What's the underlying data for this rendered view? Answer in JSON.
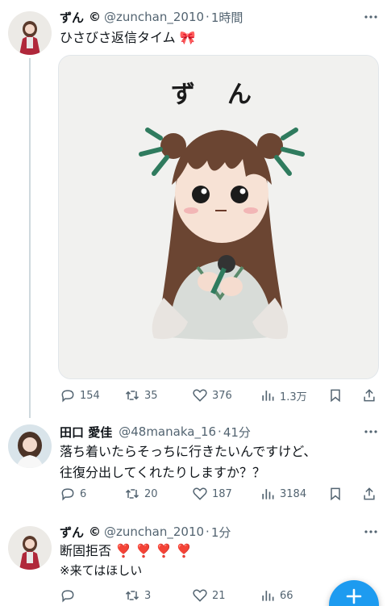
{
  "tweets": [
    {
      "name": "ずん",
      "name_mark": "©",
      "handle": "@zunchan_2010",
      "separator": "·",
      "time": "1時間",
      "text_lines": [
        "ひさびさ返信タイム 🎀"
      ],
      "media": {
        "caption_text": "ずん"
      },
      "stats": {
        "replies": "154",
        "retweets": "35",
        "likes": "376",
        "views": "1.3万"
      }
    },
    {
      "name": "田口 愛佳",
      "handle": "@48manaka_16",
      "separator": "·",
      "time": "41分",
      "text_lines": [
        "落ち着いたらそっちに行きたいんですけど、",
        "往復分出してくれたりしますか？？"
      ],
      "stats": {
        "replies": "6",
        "retweets": "20",
        "likes": "187",
        "views": "3184"
      }
    },
    {
      "name": "ずん",
      "name_mark": "©",
      "handle": "@zunchan_2010",
      "separator": "·",
      "time": "1分",
      "text_lines": [
        "断固拒否 ❣️ ❣️ ❣️ ❣️",
        "※来てはほしい"
      ],
      "stats": {
        "replies": "",
        "retweets": "3",
        "likes": "21",
        "views": "66"
      }
    }
  ],
  "colors": {
    "accent": "#1d9bf0",
    "muted": "#536471",
    "text": "#0f1419",
    "thread_line": "#cfd9de"
  },
  "icons": [
    "reply-icon",
    "retweet-icon",
    "like-icon",
    "views-icon",
    "bookmark-icon",
    "share-icon",
    "more-icon",
    "compose-icon"
  ]
}
